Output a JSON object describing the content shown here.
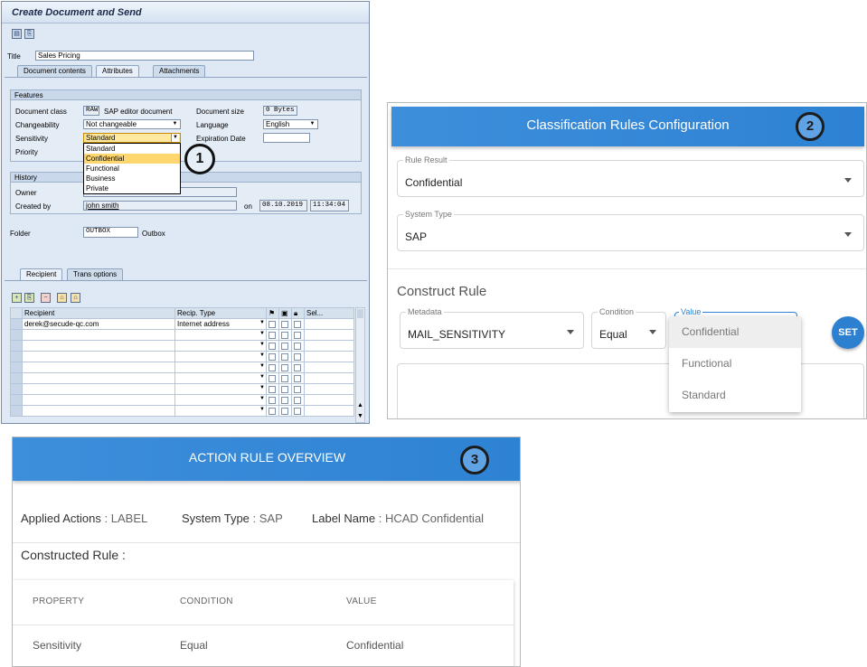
{
  "sap": {
    "title": "Create Document and Send",
    "title_label": "Title",
    "title_value": "Sales Pricing",
    "tabs": [
      "Document contents",
      "Attributes",
      "Attachments"
    ],
    "features_header": "Features",
    "doc_class_label": "Document class",
    "doc_class_code": "RAW",
    "doc_class_value": "SAP editor document",
    "doc_size_label": "Document size",
    "doc_size_value": "0 Bytes",
    "changeability_label": "Changeability",
    "changeability_value": "Not changeable",
    "language_label": "Language",
    "language_value": "English",
    "sensitivity_label": "Sensitivity",
    "sensitivity_value": "Standard",
    "expiration_label": "Expiration Date",
    "priority_label": "Priority",
    "sensitivity_options": [
      "Standard",
      "Confidential",
      "Functional",
      "Business",
      "Private"
    ],
    "history_header": "History",
    "owner_label": "Owner",
    "created_by_label": "Created by",
    "created_by_value": "john smith",
    "on_label": "on",
    "date_value": "08.10.2019",
    "time_value": "11:34:04",
    "folder_label": "Folder",
    "folder_value": "OUTBOX",
    "folder_text": "Outbox",
    "recipient_tabs": [
      "Recipient",
      "Trans options"
    ],
    "grid_headers": {
      "recipient": "Recipient",
      "type": "Recip. Type",
      "sel": "Sel..."
    },
    "grid_rows": [
      {
        "recipient": "derek@secude-qc.com",
        "type": "Internet address"
      },
      {
        "recipient": "",
        "type": ""
      },
      {
        "recipient": "",
        "type": ""
      },
      {
        "recipient": "",
        "type": ""
      },
      {
        "recipient": "",
        "type": ""
      },
      {
        "recipient": "",
        "type": ""
      },
      {
        "recipient": "",
        "type": ""
      },
      {
        "recipient": "",
        "type": ""
      },
      {
        "recipient": "",
        "type": ""
      }
    ],
    "badge": "1"
  },
  "classification": {
    "title": "Classification Rules Configuration",
    "badge": "2",
    "rule_result_label": "Rule Result",
    "rule_result_value": "Confidential",
    "system_type_label": "System Type",
    "system_type_value": "SAP",
    "construct_rule_heading": "Construct Rule",
    "metadata_label": "Metadata",
    "metadata_value": "MAIL_SENSITIVITY",
    "condition_label": "Condition",
    "condition_value": "Equal",
    "value_label": "Value",
    "value_options": [
      "Confidential",
      "Functional",
      "Standard"
    ],
    "set_button": "SET",
    "accent": "#2e82d3"
  },
  "action": {
    "title": "ACTION RULE OVERVIEW",
    "badge": "3",
    "applied_actions_label": "Applied Actions",
    "applied_actions_value": ": LABEL",
    "system_type_label": "System Type",
    "system_type_value": ": SAP",
    "label_name_label": "Label Name",
    "label_name_value": ": HCAD Confidential",
    "constructed_rule_label": "Constructed Rule :",
    "table_headers": [
      "PROPERTY",
      "CONDITION",
      "VALUE"
    ],
    "table_rows": [
      {
        "property": "Sensitivity",
        "condition": "Equal",
        "value": "Confidential"
      }
    ]
  }
}
